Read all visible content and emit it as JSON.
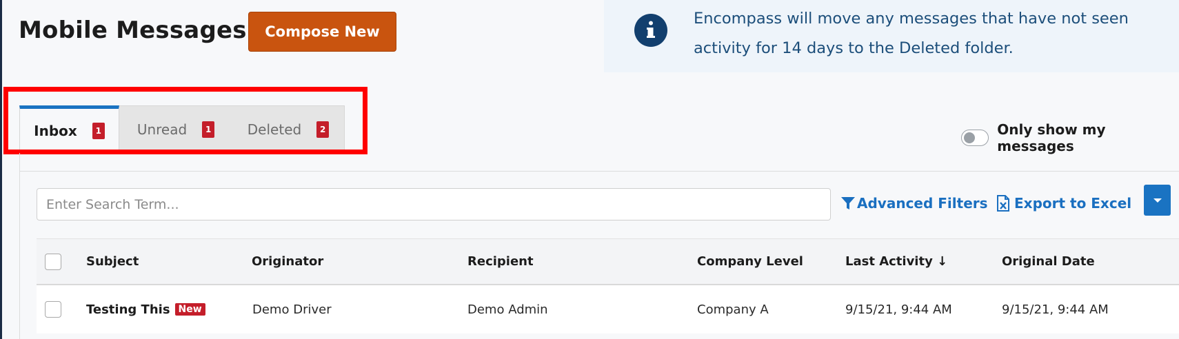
{
  "header": {
    "title": "Mobile Messages",
    "compose_label": "Compose New"
  },
  "info_banner": {
    "icon": "info-icon",
    "text": "Encompass will move any messages that have not seen activity for 14 days to the Deleted folder."
  },
  "tabs": [
    {
      "label": "Inbox",
      "badge": "1",
      "active": true
    },
    {
      "label": "Unread",
      "badge": "1",
      "active": false
    },
    {
      "label": "Deleted",
      "badge": "2",
      "active": false
    }
  ],
  "toggle": {
    "label": "Only show my messages",
    "checked": false
  },
  "toolbar": {
    "search_placeholder": "Enter Search Term...",
    "advanced_filters_label": "Advanced Filters",
    "export_label": "Export to Excel"
  },
  "table": {
    "columns": [
      "Subject",
      "Originator",
      "Recipient",
      "Company Level",
      "Last Activity ↓",
      "Original Date"
    ],
    "rows": [
      {
        "subject": "Testing This",
        "badge": "New",
        "originator": "Demo Driver",
        "recipient": "Demo Admin",
        "company_level": "Company A",
        "last_activity": "9/15/21, 9:44 AM",
        "original_date": "9/15/21, 9:44 AM"
      }
    ]
  },
  "colors": {
    "accent": "#1a73c2",
    "compose": "#c9540f",
    "badge": "#c41e2a",
    "highlight": "#ff0000",
    "info_icon_bg": "#123f6e"
  }
}
